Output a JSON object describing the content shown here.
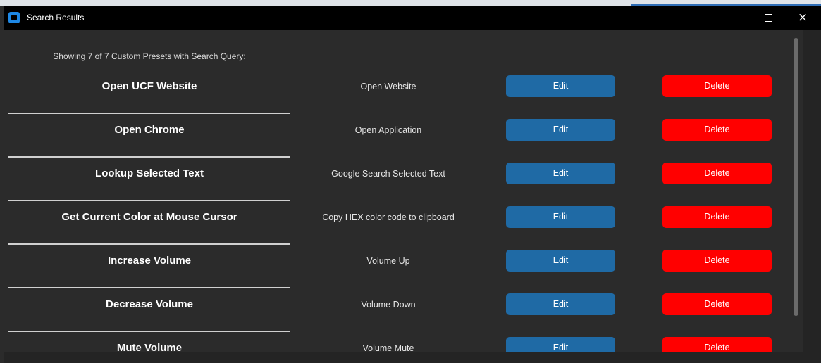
{
  "window": {
    "title": "Search Results",
    "controls": {
      "minimize": "minimize-icon",
      "maximize": "maximize-icon",
      "close": "×"
    }
  },
  "summary": "Showing 7 of 7 Custom Presets with Search Query:",
  "presets": [
    {
      "name": "Open UCF Website",
      "action": "Open Website",
      "edit_label": "Edit",
      "delete_label": "Delete"
    },
    {
      "name": "Open Chrome",
      "action": "Open Application",
      "edit_label": "Edit",
      "delete_label": "Delete"
    },
    {
      "name": "Lookup Selected Text",
      "action": "Google Search Selected Text",
      "edit_label": "Edit",
      "delete_label": "Delete"
    },
    {
      "name": "Get Current Color at Mouse Cursor",
      "action": "Copy HEX color code to clipboard",
      "edit_label": "Edit",
      "delete_label": "Delete"
    },
    {
      "name": "Increase Volume",
      "action": "Volume Up",
      "edit_label": "Edit",
      "delete_label": "Delete"
    },
    {
      "name": "Decrease Volume",
      "action": "Volume Down",
      "edit_label": "Edit",
      "delete_label": "Delete"
    },
    {
      "name": "Mute Volume",
      "action": "Volume Mute",
      "edit_label": "Edit",
      "delete_label": "Delete"
    }
  ],
  "colors": {
    "edit_button": "#1f6aa5",
    "delete_button": "#ff0000",
    "background": "#2b2b2b",
    "titlebar": "#000000"
  }
}
